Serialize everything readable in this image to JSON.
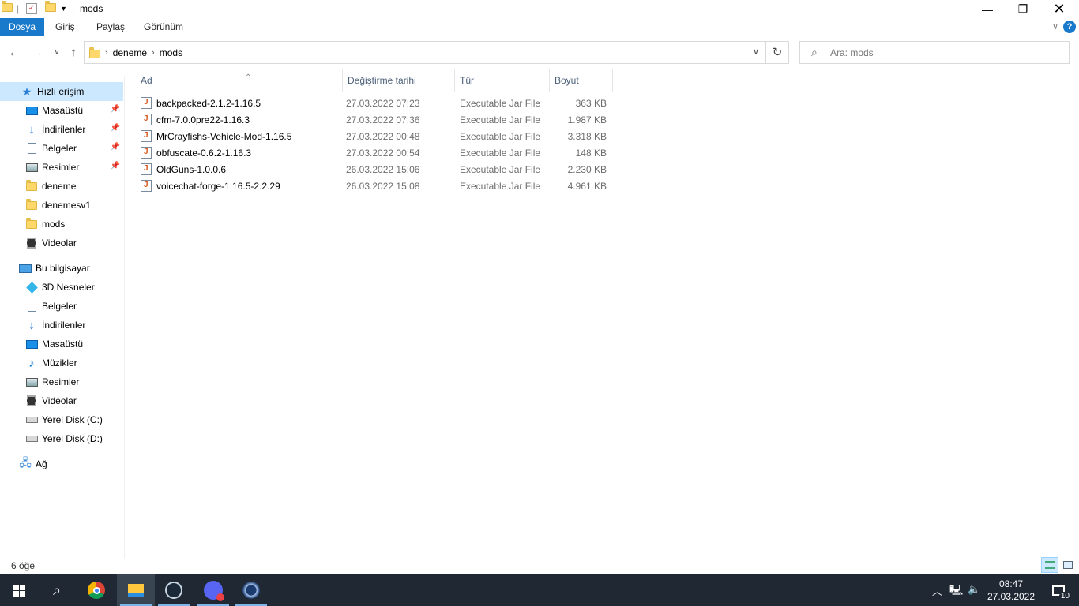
{
  "window": {
    "title": "mods",
    "minimize_icon": "minimize-icon",
    "maximize_icon": "restore-icon",
    "close_icon": "close-icon"
  },
  "ribbon": {
    "tabs": [
      {
        "label": "Dosya",
        "active": true
      },
      {
        "label": "Giriş",
        "active": false
      },
      {
        "label": "Paylaş",
        "active": false
      },
      {
        "label": "Görünüm",
        "active": false
      }
    ],
    "help_label": "?"
  },
  "address": {
    "crumbs": [
      "deneme",
      "mods"
    ],
    "search_placeholder": "Ara: mods"
  },
  "nav": {
    "quick_access": "Hızlı erişim",
    "items": [
      {
        "label": "Masaüstü",
        "icon": "desktop-icon",
        "pinned": true
      },
      {
        "label": "İndirilenler",
        "icon": "download-icon",
        "pinned": true
      },
      {
        "label": "Belgeler",
        "icon": "documents-icon",
        "pinned": true
      },
      {
        "label": "Resimler",
        "icon": "pictures-icon",
        "pinned": true
      },
      {
        "label": "deneme",
        "icon": "folder-icon",
        "pinned": false
      },
      {
        "label": "denemesv1",
        "icon": "folder-icon",
        "pinned": false
      },
      {
        "label": "mods",
        "icon": "folder-icon",
        "pinned": false
      },
      {
        "label": "Videolar",
        "icon": "videos-icon",
        "pinned": false
      }
    ],
    "this_pc": "Bu bilgisayar",
    "pc_items": [
      {
        "label": "3D Nesneler",
        "icon": "3d-objects-icon"
      },
      {
        "label": "Belgeler",
        "icon": "documents-icon"
      },
      {
        "label": "İndirilenler",
        "icon": "download-icon"
      },
      {
        "label": "Masaüstü",
        "icon": "desktop-icon"
      },
      {
        "label": "Müzikler",
        "icon": "music-icon"
      },
      {
        "label": "Resimler",
        "icon": "pictures-icon"
      },
      {
        "label": "Videolar",
        "icon": "videos-icon"
      },
      {
        "label": "Yerel Disk (C:)",
        "icon": "drive-icon"
      },
      {
        "label": "Yerel Disk (D:)",
        "icon": "drive-icon"
      }
    ],
    "network": "Ağ"
  },
  "columns": {
    "name": "Ad",
    "date": "Değiştirme tarihi",
    "type": "Tür",
    "size": "Boyut"
  },
  "files": [
    {
      "name": "backpacked-2.1.2-1.16.5",
      "date": "27.03.2022 07:23",
      "type": "Executable Jar File",
      "size": "363 KB"
    },
    {
      "name": "cfm-7.0.0pre22-1.16.3",
      "date": "27.03.2022 07:36",
      "type": "Executable Jar File",
      "size": "1.987 KB"
    },
    {
      "name": "MrCrayfishs-Vehicle-Mod-1.16.5",
      "date": "27.03.2022 00:48",
      "type": "Executable Jar File",
      "size": "3.318 KB"
    },
    {
      "name": "obfuscate-0.6.2-1.16.3",
      "date": "27.03.2022 00:54",
      "type": "Executable Jar File",
      "size": "148 KB"
    },
    {
      "name": "OldGuns-1.0.0.6",
      "date": "26.03.2022 15:06",
      "type": "Executable Jar File",
      "size": "2.230 KB"
    },
    {
      "name": "voicechat-forge-1.16.5-2.2.29",
      "date": "26.03.2022 15:08",
      "type": "Executable Jar File",
      "size": "4.961 KB"
    }
  ],
  "status": {
    "count_text": "6 öğe"
  },
  "taskbar": {
    "time": "08:47",
    "date": "27.03.2022",
    "notification_count": "10",
    "apps": [
      "chrome-icon",
      "file-explorer-icon",
      "steam-icon",
      "discord-icon",
      "app-icon"
    ]
  }
}
